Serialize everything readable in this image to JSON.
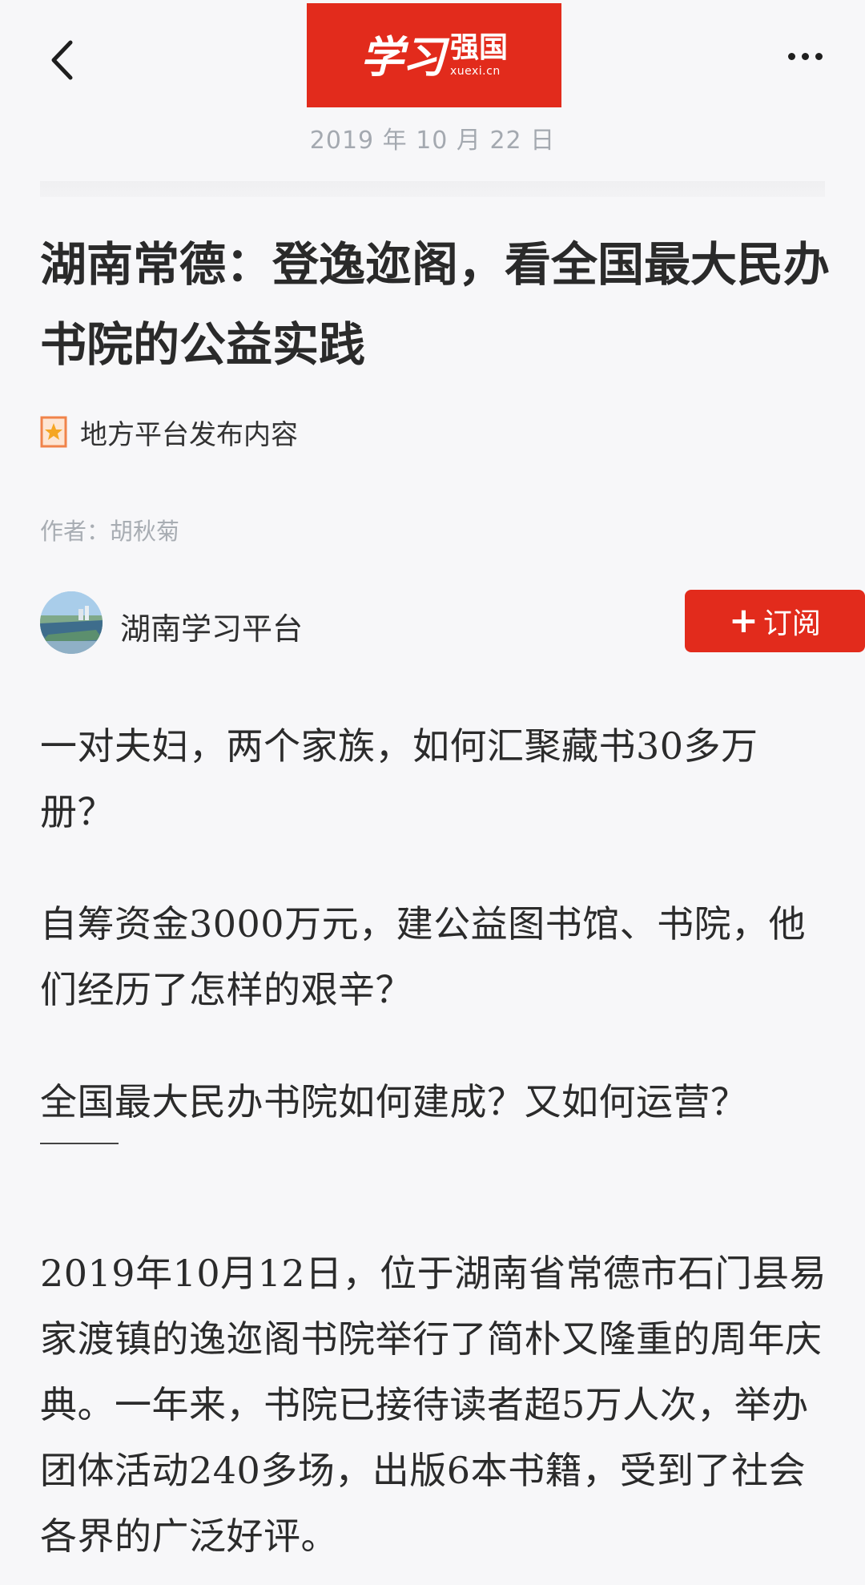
{
  "header": {
    "logo_main": "学习",
    "logo_brand": "强国",
    "logo_url": "xuexi.cn",
    "back_icon": "chevron-left-icon",
    "more_icon": "more-horizontal-icon",
    "brand_color": "#e22b1c"
  },
  "article": {
    "date": "2019 年 10 月 22 日",
    "title": "湖南常德：登逸迩阁，看全国最大民办书院的公益实践",
    "source_label": "地方平台发布内容",
    "source_icon": "bookmark-star-icon",
    "author": "作者：胡秋菊",
    "channel_name": "湖南学习平台",
    "subscribe_label": "订阅",
    "subscribe_plus": "+",
    "paragraphs": [
      "一对夫妇，两个家族，如何汇聚藏书30多万册？",
      "自筹资金3000万元，建公益图书馆、书院，他们经历了怎样的艰辛？",
      "全国最大民办书院如何建成？又如何运营？",
      "2019年10月12日，位于湖南省常德市石门县易家渡镇的逸迩阁书院举行了简朴又隆重的周年庆典。一年来，书院已接待读者超5万人次，举办团体活动240多场，出版6本书籍，受到了社会各界的广泛好评。"
    ]
  }
}
